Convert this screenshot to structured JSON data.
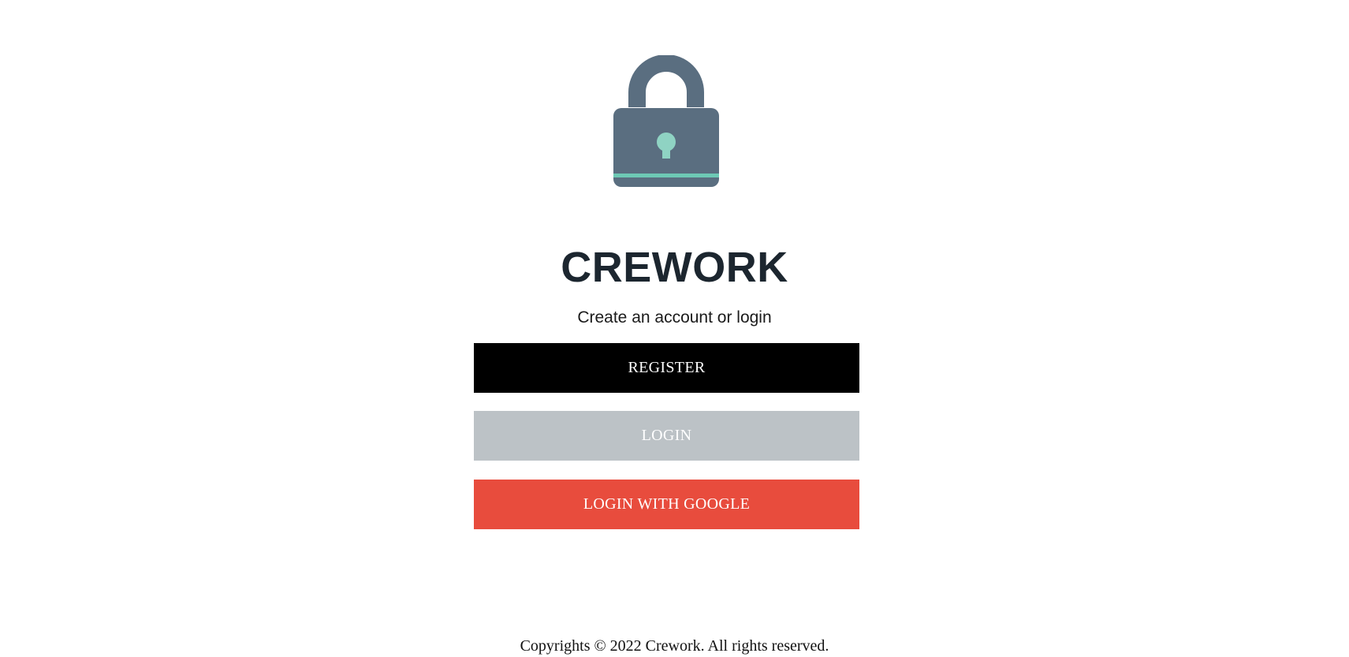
{
  "app": {
    "logo_icon": "padlock-icon",
    "title": "CREWORK",
    "subtitle": "Create an account or login"
  },
  "actions": {
    "register_label": "REGISTER",
    "login_label": "LOGIN",
    "google_label": "LOGIN WITH GOOGLE"
  },
  "footer": {
    "text": "Copyrights © 2022 Crework. All rights reserved."
  },
  "colors": {
    "title": "#1c262f",
    "lock_body": "#5a6e80",
    "lock_accent": "#6dc9b5",
    "keyhole": "#8fd3c3",
    "register_bg": "#000000",
    "login_bg": "#bcc2c6",
    "google_bg": "#e84c3d"
  }
}
